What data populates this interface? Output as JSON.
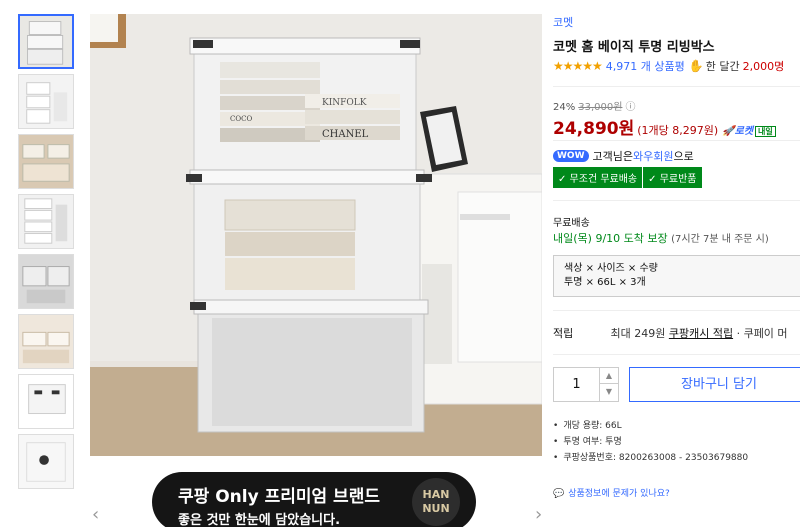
{
  "thumbnails": [
    {
      "name": "thumb-1",
      "active": true
    },
    {
      "name": "thumb-2",
      "active": false
    },
    {
      "name": "thumb-3",
      "active": false
    },
    {
      "name": "thumb-4",
      "active": false
    },
    {
      "name": "thumb-5",
      "active": false
    },
    {
      "name": "thumb-6",
      "active": false
    },
    {
      "name": "thumb-7",
      "active": false
    },
    {
      "name": "thumb-8",
      "active": false
    }
  ],
  "main_image": {
    "book_labels": [
      "KINFOLK",
      "CHANEL",
      "COCO"
    ]
  },
  "banner": {
    "line1": "쿠팡 Only 프리미엄 브랜드",
    "line2": "좋은 것만 한눈에 담았습니다.",
    "logo_top": "HAN",
    "logo_bottom": "NUN"
  },
  "product": {
    "brand": "코멧",
    "title": "코멧 홈 베이직 투명 리빙박스",
    "rating_stars": "★★★★★",
    "review_count": "4,971 개 상품평",
    "month_label": "한 달간",
    "month_count": "2,000명"
  },
  "price": {
    "discount": "24%",
    "original": "33,000원",
    "sale": "24,890원",
    "unit": "(1개당 8,297원)",
    "rocket": "로켓",
    "rocket_badge": "내일"
  },
  "wow": {
    "badge": "WOW",
    "prefix": "고객님은",
    "link": "와우회원",
    "suffix": "으로",
    "tags": [
      "✓ 무조건 무료배송",
      "✓ 무료반품"
    ]
  },
  "shipping": {
    "label": "무료배송",
    "date": "내일(목) 9/10",
    "date_suffix": "도착 보장",
    "note": "(7시간 7분 내 주문 시)"
  },
  "option": {
    "line1": "색상 × 사이즈 × 수량",
    "line2": "투명 × 66L × 3개"
  },
  "reward": {
    "label": "적립",
    "text": "최대 249원",
    "link": "쿠팡캐시 적립",
    "more": "· 쿠페이 머"
  },
  "purchase": {
    "quantity": "1",
    "cart_label": "장바구니 담기"
  },
  "specs": [
    "개당 용량: 66L",
    "투명 여부: 투명",
    "쿠팡상품번호: 8200263008 - 23503679880"
  ],
  "report_label": "상품정보에 문제가 있나요?"
}
